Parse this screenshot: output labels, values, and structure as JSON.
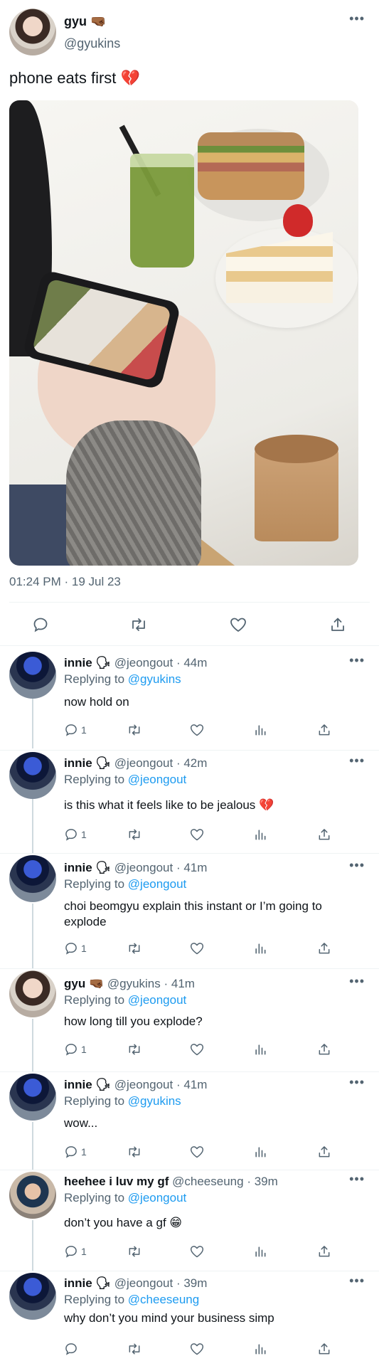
{
  "main_tweet": {
    "author_name": "gyu 🤜🏾",
    "author_handle": "@gyukins",
    "text": "phone eats first 💔",
    "timestamp": "01:24 PM · 19 Jul 23",
    "more": "•••"
  },
  "replies": [
    {
      "name": "innie 🗣",
      "handle": "@jeongout",
      "time": "44m",
      "replying_prefix": "Replying to ",
      "replying_to": "@gyukins",
      "text": "now hold on",
      "reply_count": "1",
      "more": "•••"
    },
    {
      "name": "innie 🗣",
      "handle": "@jeongout",
      "time": "42m",
      "replying_prefix": "Replying to ",
      "replying_to": "@jeongout",
      "text": "is this what it feels like to be jealous 💔",
      "reply_count": "1",
      "more": "•••"
    },
    {
      "name": "innie 🗣",
      "handle": "@jeongout",
      "time": "41m",
      "replying_prefix": "Replying to ",
      "replying_to": "@jeongout",
      "text": "choi beomgyu explain this instant or I’m going to explode",
      "reply_count": "1",
      "more": "•••"
    },
    {
      "name": "gyu 🤜🏾",
      "handle": "@gyukins",
      "time": "41m",
      "replying_prefix": "Replying to ",
      "replying_to": "@jeongout",
      "text": "how long till you explode?",
      "reply_count": "1",
      "more": "•••"
    },
    {
      "name": "innie 🗣",
      "handle": "@jeongout",
      "time": "41m",
      "replying_prefix": "Replying to ",
      "replying_to": "@gyukins",
      "text": "wow...",
      "reply_count": "1",
      "more": "•••"
    },
    {
      "name": "heehee i luv my gf",
      "handle": "@cheeseung",
      "time": "39m",
      "replying_prefix": "Replying to ",
      "replying_to": "@jeongout",
      "text": "don’t you have a gf 😁",
      "reply_count": "1",
      "more": "•••"
    },
    {
      "name": "innie 🗣",
      "handle": "@jeongout",
      "time": "39m",
      "replying_prefix": "Replying to ",
      "replying_to": "@cheeseung",
      "text": "why don’t you mind your business simp",
      "reply_count": "",
      "more": "•••"
    }
  ],
  "colors": {
    "link": "#1d9bf0",
    "muted": "#536471",
    "text": "#0f1419"
  },
  "icons": [
    "comment-icon",
    "retweet-icon",
    "like-icon",
    "share-icon",
    "views-icon",
    "more-icon"
  ]
}
